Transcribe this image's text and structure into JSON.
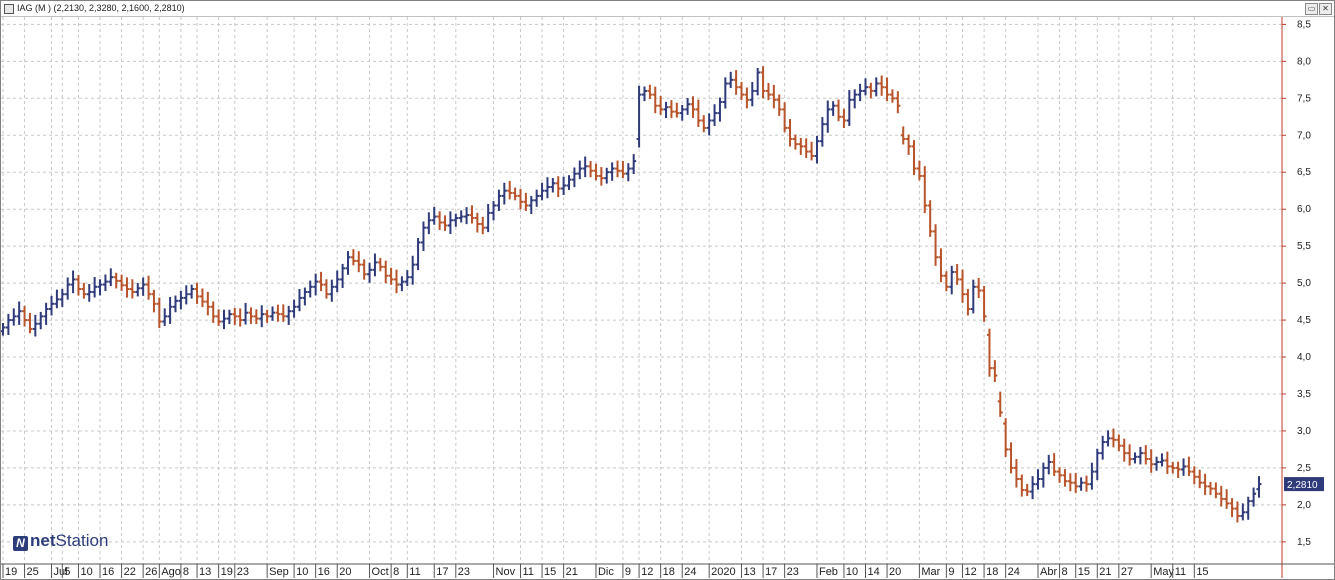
{
  "window": {
    "title": "IAG (M ) (2,2130, 2,3280, 2,1600, 2,2810)",
    "buttons": [
      "▭",
      "✕"
    ]
  },
  "logo": {
    "mark": "N",
    "net": "net",
    "station": "Station"
  },
  "colors": {
    "up": "#2e3a7a",
    "down": "#b8532a",
    "grid": "#c8c8c8",
    "axis": "#c0392b",
    "last_label_bg": "#2e3a7a"
  },
  "chart_data": {
    "type": "ohlc",
    "symbol": "IAG",
    "ylim": [
      1.2,
      8.6
    ],
    "yticks": [
      "1,5",
      "2,0",
      "2,5",
      "3,0",
      "3,5",
      "4,0",
      "4,5",
      "5,0",
      "5,5",
      "6,0",
      "6,5",
      "7,0",
      "7,5",
      "8,0",
      "8,5"
    ],
    "ytick_values": [
      1.5,
      2.0,
      2.5,
      3.0,
      3.5,
      4.0,
      4.5,
      5.0,
      5.5,
      6.0,
      6.5,
      7.0,
      7.5,
      8.0,
      8.5
    ],
    "last_value_label": "2,2810",
    "last_value": 2.281,
    "x_labels": [
      {
        "i": 0,
        "t": "19"
      },
      {
        "i": 4,
        "t": "25"
      },
      {
        "i": 9,
        "t": "Jul"
      },
      {
        "i": 11,
        "t": "5"
      },
      {
        "i": 14,
        "t": "10"
      },
      {
        "i": 18,
        "t": "16"
      },
      {
        "i": 22,
        "t": "22"
      },
      {
        "i": 26,
        "t": "26"
      },
      {
        "i": 29,
        "t": "Ago"
      },
      {
        "i": 33,
        "t": "8"
      },
      {
        "i": 36,
        "t": "13"
      },
      {
        "i": 40,
        "t": "19"
      },
      {
        "i": 43,
        "t": "23"
      },
      {
        "i": 49,
        "t": "Sep"
      },
      {
        "i": 54,
        "t": "10"
      },
      {
        "i": 58,
        "t": "16"
      },
      {
        "i": 62,
        "t": "20"
      },
      {
        "i": 68,
        "t": "Oct"
      },
      {
        "i": 72,
        "t": "8"
      },
      {
        "i": 75,
        "t": "11"
      },
      {
        "i": 80,
        "t": "17"
      },
      {
        "i": 84,
        "t": "23"
      },
      {
        "i": 91,
        "t": "Nov"
      },
      {
        "i": 96,
        "t": "11"
      },
      {
        "i": 100,
        "t": "15"
      },
      {
        "i": 104,
        "t": "21"
      },
      {
        "i": 110,
        "t": "Dic"
      },
      {
        "i": 115,
        "t": "9"
      },
      {
        "i": 118,
        "t": "12"
      },
      {
        "i": 122,
        "t": "18"
      },
      {
        "i": 126,
        "t": "24"
      },
      {
        "i": 131,
        "t": "2020"
      },
      {
        "i": 137,
        "t": "13"
      },
      {
        "i": 141,
        "t": "17"
      },
      {
        "i": 145,
        "t": "23"
      },
      {
        "i": 151,
        "t": "Feb"
      },
      {
        "i": 156,
        "t": "10"
      },
      {
        "i": 160,
        "t": "14"
      },
      {
        "i": 164,
        "t": "20"
      },
      {
        "i": 170,
        "t": "Mar"
      },
      {
        "i": 175,
        "t": "9"
      },
      {
        "i": 178,
        "t": "12"
      },
      {
        "i": 182,
        "t": "18"
      },
      {
        "i": 186,
        "t": "24"
      },
      {
        "i": 192,
        "t": "Abr"
      },
      {
        "i": 196,
        "t": "8"
      },
      {
        "i": 199,
        "t": "15"
      },
      {
        "i": 203,
        "t": "21"
      },
      {
        "i": 207,
        "t": "27"
      },
      {
        "i": 213,
        "t": "May"
      },
      {
        "i": 217,
        "t": "11"
      },
      {
        "i": 221,
        "t": "15"
      }
    ],
    "closes": [
      4.4,
      4.5,
      4.55,
      4.62,
      4.5,
      4.38,
      4.45,
      4.55,
      4.65,
      4.72,
      4.78,
      4.85,
      4.98,
      5.05,
      4.92,
      4.85,
      4.88,
      4.95,
      4.98,
      5.02,
      5.08,
      5.03,
      4.97,
      4.92,
      4.88,
      4.93,
      4.98,
      4.85,
      4.72,
      4.48,
      4.55,
      4.68,
      4.76,
      4.8,
      4.85,
      4.92,
      4.82,
      4.75,
      4.68,
      4.55,
      4.48,
      4.52,
      4.58,
      4.55,
      4.5,
      4.6,
      4.55,
      4.52,
      4.58,
      4.55,
      4.6,
      4.58,
      4.55,
      4.62,
      4.68,
      4.8,
      4.88,
      4.95,
      5.02,
      4.98,
      4.85,
      4.95,
      5.05,
      5.2,
      5.35,
      5.3,
      5.25,
      5.12,
      5.18,
      5.28,
      5.22,
      5.1,
      5.05,
      4.98,
      5.02,
      5.08,
      5.25,
      5.55,
      5.75,
      5.85,
      5.9,
      5.82,
      5.78,
      5.85,
      5.88,
      5.9,
      5.92,
      5.88,
      5.8,
      5.75,
      5.95,
      6.05,
      6.18,
      6.25,
      6.22,
      6.18,
      6.1,
      6.05,
      6.12,
      6.18,
      6.25,
      6.3,
      6.35,
      6.28,
      6.32,
      6.4,
      6.48,
      6.55,
      6.58,
      6.52,
      6.45,
      6.42,
      6.5,
      6.55,
      6.52,
      6.48,
      6.55,
      6.65,
      7.55,
      7.6,
      7.55,
      7.4,
      7.35,
      7.38,
      7.32,
      7.3,
      7.35,
      7.42,
      7.35,
      7.2,
      7.1,
      7.2,
      7.3,
      7.45,
      7.7,
      7.75,
      7.65,
      7.55,
      7.48,
      7.6,
      7.85,
      7.6,
      7.55,
      7.48,
      7.35,
      7.1,
      6.95,
      6.88,
      6.85,
      6.78,
      6.72,
      6.92,
      7.15,
      7.35,
      7.4,
      7.25,
      7.2,
      7.48,
      7.55,
      7.6,
      7.65,
      7.6,
      7.7,
      7.65,
      7.55,
      7.5,
      7.4,
      6.95,
      6.85,
      6.55,
      6.45,
      6.05,
      5.7,
      5.35,
      5.1,
      4.95,
      5.15,
      5.05,
      4.85,
      4.65,
      4.95,
      4.9,
      4.55,
      3.85,
      3.75,
      3.25,
      2.75,
      2.5,
      2.35,
      2.2,
      2.18,
      2.28,
      2.35,
      2.5,
      2.58,
      2.45,
      2.4,
      2.32,
      2.3,
      2.25,
      2.3,
      2.28,
      2.45,
      2.7,
      2.85,
      2.9,
      2.88,
      2.8,
      2.7,
      2.62,
      2.65,
      2.7,
      2.62,
      2.55,
      2.58,
      2.6,
      2.52,
      2.5,
      2.48,
      2.52,
      2.45,
      2.38,
      2.3,
      2.25,
      2.22,
      2.15,
      2.08,
      2.02,
      1.95,
      1.85,
      1.9,
      2.05,
      2.15,
      2.281
    ],
    "opens": [
      4.35,
      4.4,
      4.5,
      4.55,
      4.62,
      4.5,
      4.38,
      4.45,
      4.55,
      4.65,
      4.72,
      4.78,
      4.85,
      4.98,
      5.05,
      4.92,
      4.85,
      4.88,
      4.95,
      4.98,
      5.02,
      5.08,
      5.03,
      4.97,
      4.92,
      4.88,
      4.93,
      4.98,
      4.85,
      4.72,
      4.48,
      4.55,
      4.68,
      4.76,
      4.8,
      4.85,
      4.92,
      4.82,
      4.75,
      4.68,
      4.55,
      4.48,
      4.52,
      4.58,
      4.55,
      4.5,
      4.6,
      4.55,
      4.52,
      4.58,
      4.55,
      4.6,
      4.58,
      4.55,
      4.62,
      4.68,
      4.8,
      4.88,
      4.95,
      5.02,
      4.98,
      4.85,
      4.95,
      5.05,
      5.2,
      5.35,
      5.3,
      5.25,
      5.12,
      5.18,
      5.28,
      5.22,
      5.1,
      5.05,
      4.98,
      5.02,
      5.08,
      5.25,
      5.55,
      5.75,
      5.85,
      5.9,
      5.82,
      5.78,
      5.85,
      5.88,
      5.9,
      5.92,
      5.88,
      5.8,
      5.75,
      5.95,
      6.05,
      6.18,
      6.25,
      6.22,
      6.18,
      6.1,
      6.05,
      6.12,
      6.18,
      6.25,
      6.3,
      6.35,
      6.28,
      6.32,
      6.4,
      6.48,
      6.55,
      6.58,
      6.52,
      6.45,
      6.42,
      6.5,
      6.55,
      6.52,
      6.48,
      6.55,
      6.95,
      7.55,
      7.6,
      7.55,
      7.4,
      7.35,
      7.38,
      7.32,
      7.3,
      7.35,
      7.42,
      7.35,
      7.2,
      7.1,
      7.2,
      7.3,
      7.45,
      7.7,
      7.75,
      7.65,
      7.55,
      7.48,
      7.6,
      7.85,
      7.6,
      7.55,
      7.48,
      7.35,
      7.1,
      6.95,
      6.88,
      6.85,
      6.78,
      6.72,
      6.92,
      7.15,
      7.35,
      7.4,
      7.25,
      7.2,
      7.48,
      7.55,
      7.6,
      7.65,
      7.6,
      7.7,
      7.65,
      7.55,
      7.5,
      7.0,
      6.95,
      6.85,
      6.55,
      6.45,
      6.05,
      5.7,
      5.35,
      5.1,
      4.95,
      5.15,
      5.05,
      4.85,
      4.65,
      4.95,
      4.9,
      4.3,
      3.85,
      3.4,
      3.1,
      2.75,
      2.5,
      2.35,
      2.2,
      2.18,
      2.28,
      2.35,
      2.5,
      2.58,
      2.45,
      2.4,
      2.32,
      2.3,
      2.25,
      2.3,
      2.28,
      2.45,
      2.7,
      2.85,
      2.9,
      2.88,
      2.8,
      2.7,
      2.62,
      2.65,
      2.7,
      2.62,
      2.55,
      2.58,
      2.6,
      2.52,
      2.5,
      2.48,
      2.52,
      2.45,
      2.38,
      2.3,
      2.25,
      2.22,
      2.15,
      2.08,
      2.02,
      1.95,
      1.85,
      1.9,
      2.05,
      2.213
    ]
  }
}
